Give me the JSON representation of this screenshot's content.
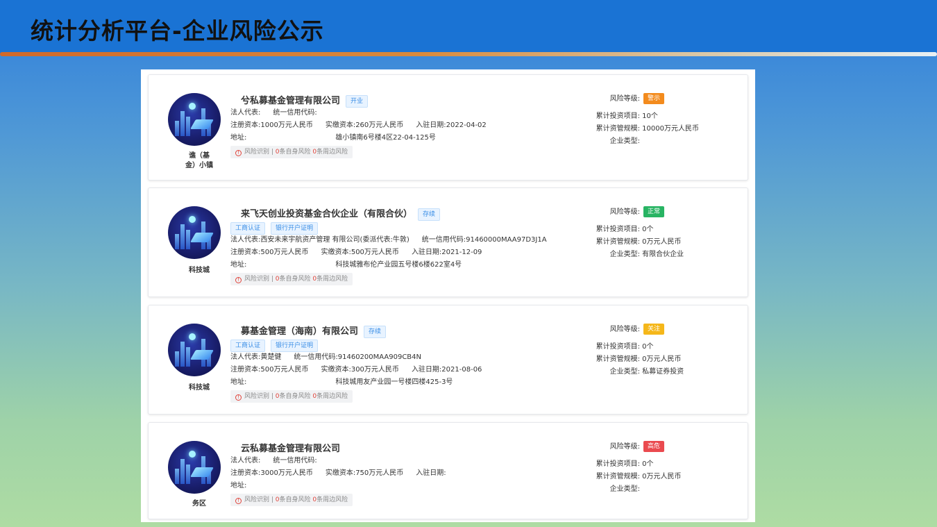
{
  "header": {
    "title": "统计分析平台-企业风险公示"
  },
  "labels": {
    "risk_level": "风险等级:",
    "legal_rep": "法人代表:",
    "credit_code": "统一信用代码:",
    "reg_capital": "注册资本:",
    "paid_capital": "实缴资本:",
    "join_date": "入驻日期:",
    "address": "地址:",
    "total_projects": "累计投资项目:",
    "total_scale": "累计资管规模:",
    "company_type": "企业类型:"
  },
  "colors": {
    "警示": "#f38b1d",
    "正常": "#28b463",
    "关注": "#f5b71a",
    "高危": "#ea4a4f"
  },
  "cards": [
    {
      "name": "兮私募基金管理有限公司",
      "status": "开业",
      "tags": [],
      "legal_rep": "",
      "credit_code": "",
      "reg_capital": "1000万元人民币",
      "paid_capital": "260万元人民币",
      "join_date": "2022-04-02",
      "address": "雄小镇南6号楼4区22-04-125号",
      "city_lines": [
        "谯（基",
        "金）小镇"
      ],
      "risk_level": "警示",
      "total_projects": "10个",
      "total_scale": "10000万元人民币",
      "company_type": "",
      "risk_strip": {
        "label": "风险识别 |",
        "self_count": "0",
        "self_text": "条自身风险",
        "near_count": "0",
        "near_text": "条周边风险"
      }
    },
    {
      "name": "来飞天创业投资基金合伙企业（有限合伙）",
      "status": "存续",
      "tags": [
        "工商认证",
        "银行开户证明"
      ],
      "legal_rep": "西安未来宇航资产管理 有限公司(委派代表:牛敦)",
      "credit_code": "91460000MAA97D3J1A",
      "reg_capital": "500万元人民币",
      "paid_capital": "500万元人民币",
      "join_date": "2021-12-09",
      "address": "科技城雅布伦产业园五号楼6楼622室4号",
      "city_lines": [
        "科技城"
      ],
      "risk_level": "正常",
      "total_projects": "0个",
      "total_scale": "0万元人民币",
      "company_type": "有限合伙企业",
      "risk_strip": {
        "label": "风险识别 |",
        "self_count": "0",
        "self_text": "条自身风险",
        "near_count": "0",
        "near_text": "条周边风险"
      }
    },
    {
      "name": "募基金管理（海南）有限公司",
      "status": "存续",
      "tags": [
        "工商认证",
        "银行开户证明"
      ],
      "legal_rep": "黄楚健",
      "credit_code": "91460200MAA909CB4N",
      "reg_capital": "500万元人民币",
      "paid_capital": "300万元人民币",
      "join_date": "2021-08-06",
      "address": "科技城用友产业园一号楼四楼425-3号",
      "city_lines": [
        "科技城"
      ],
      "risk_level": "关注",
      "total_projects": "0个",
      "total_scale": "0万元人民币",
      "company_type": "私募证券投资",
      "risk_strip": {
        "label": "风险识别 |",
        "self_count": "0",
        "self_text": "条自身风险",
        "near_count": "0",
        "near_text": "条周边风险"
      }
    },
    {
      "name": "云私募基金管理有限公司",
      "status": "",
      "tags": [],
      "legal_rep": "",
      "credit_code": "",
      "reg_capital": "3000万元人民币",
      "paid_capital": "750万元人民币",
      "join_date": "",
      "address": "",
      "city_lines": [
        "务区"
      ],
      "risk_level": "高危",
      "total_projects": "0个",
      "total_scale": "0万元人民币",
      "company_type": "",
      "risk_strip": {
        "label": "风险识别 |",
        "self_count": "0",
        "self_text": "条自身风险",
        "near_count": "0",
        "near_text": "条周边风险"
      }
    }
  ]
}
